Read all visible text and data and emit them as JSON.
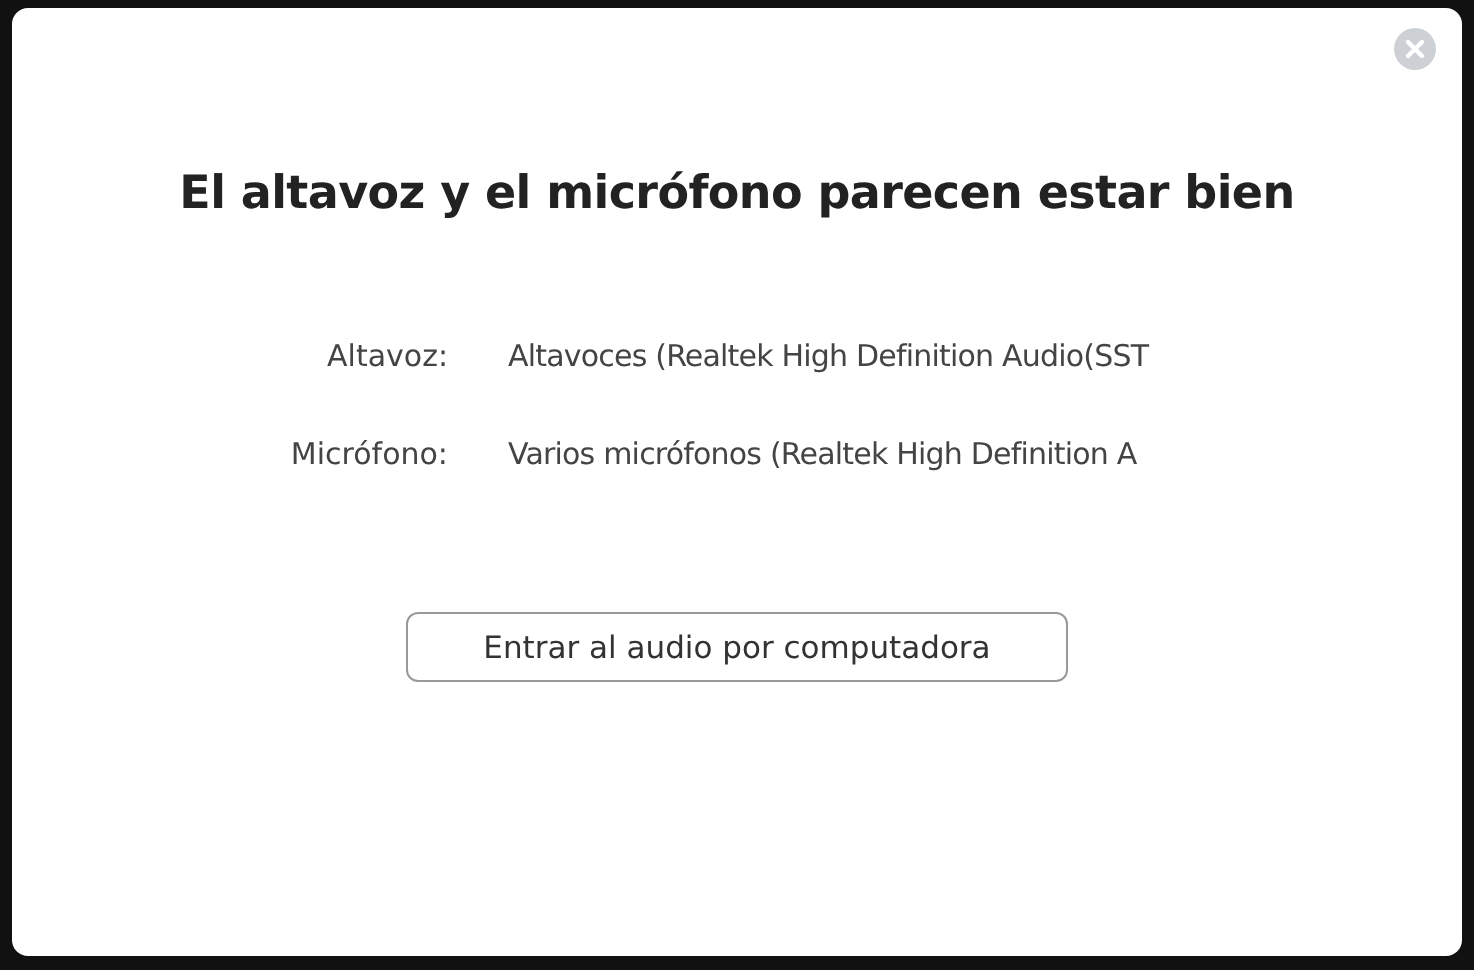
{
  "dialog": {
    "title": "El altavoz y el micrófono parecen estar bien",
    "devices": [
      {
        "label": "Altavoz:",
        "value": "Altavoces (Realtek High Definition Audio(SST"
      },
      {
        "label": "Micrófono:",
        "value": "Varios micrófonos (Realtek High Definition A"
      }
    ],
    "button": "Entrar al audio por computadora"
  }
}
